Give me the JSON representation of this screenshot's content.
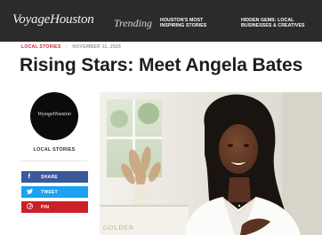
{
  "header": {
    "logo": "VoyageHouston",
    "trending_label": "Trending",
    "nav_links": [
      {
        "line1": "HOUSTON'S MOST",
        "line2": "INSPIRING STORIES"
      },
      {
        "line1": "HIDDEN GEMS: LOCAL",
        "line2": "BUSINESSES & CREATIVES"
      }
    ]
  },
  "article": {
    "category": "LOCAL STORIES",
    "date": "NOVEMBER 11, 2025",
    "title": "Rising Stars: Meet Angela Bates"
  },
  "sidebar": {
    "avatar_text": "VoyageHouston",
    "category_label": "LOCAL STORIES",
    "share_buttons": [
      {
        "label": "SHARE",
        "icon": "facebook-icon",
        "glyph": "f",
        "color": "#3b5998"
      },
      {
        "label": "TWEET",
        "icon": "twitter-icon",
        "glyph": "❧",
        "color": "#1da1f2"
      },
      {
        "label": "PIN",
        "icon": "pinterest-icon",
        "glyph": "Ⓟ",
        "color": "#cb2027"
      }
    ]
  },
  "photo": {
    "sign_text": "GOLDEN"
  }
}
